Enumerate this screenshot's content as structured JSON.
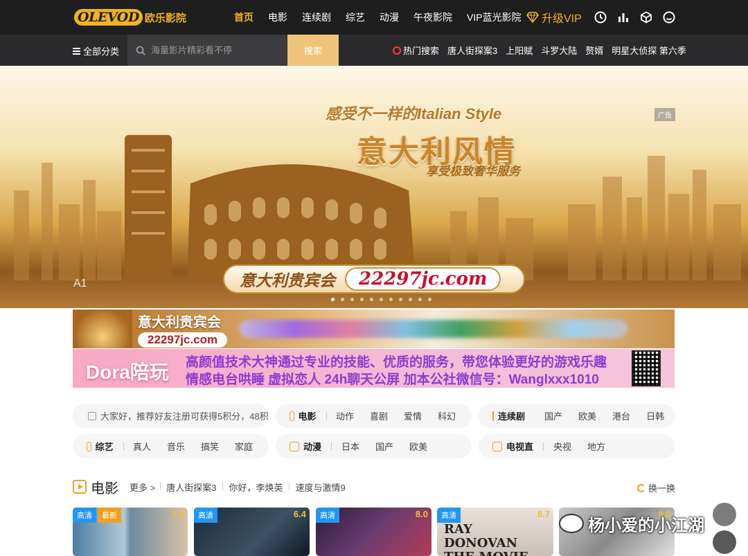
{
  "brand": {
    "logo_mark": "OLEVOD",
    "logo_text": "欧乐影院"
  },
  "nav": [
    {
      "label": "首页",
      "active": true
    },
    {
      "label": "电影"
    },
    {
      "label": "连续剧"
    },
    {
      "label": "综艺"
    },
    {
      "label": "动漫"
    },
    {
      "label": "午夜影院"
    },
    {
      "label": "VIP蓝光影院"
    }
  ],
  "vip_label": "升级VIP",
  "top_icons": [
    "clock-icon",
    "bar-chart-icon",
    "cube-icon",
    "smiley-icon"
  ],
  "subbar": {
    "all_categories": "全部分类",
    "search_placeholder": "海量影片精彩看不停",
    "search_button": "搜索",
    "hot_label": "热门搜索",
    "hot_items": [
      "唐人街探案3",
      "上阳赋",
      "斗罗大陆",
      "赘婿",
      "明星大侦探 第六季"
    ]
  },
  "banner": {
    "subtitle": "感受不一样的Italian Style",
    "title": "意大利风情",
    "slogan": "享受极致奢华服务",
    "ad_tag": "广告",
    "pill_left": "意大利贵宾会",
    "pill_right": "22297jc.com",
    "slide_label": "A1",
    "slide_count": 11,
    "active_slide": 0
  },
  "ad_strip_1": {
    "title": "意大利贵宾会",
    "url": "22297jc.com"
  },
  "ad_strip_2": {
    "brand": "Dora陪玩",
    "line1": "高颜值技术大神通过专业的技能、优质的服务，带您体验更好的游戏乐趣",
    "line2": "情感电台哄睡  虚拟恋人  24h聊天公屏  加本公社微信号：Wanglxxx1010"
  },
  "notice": "大家好，推荐好友注册可获得5积分，48积",
  "categories": [
    {
      "head": "电影",
      "subs": [
        "动作",
        "喜剧",
        "爱情",
        "科幻"
      ]
    },
    {
      "head": "连续剧",
      "subs": [
        "国产",
        "欧美",
        "港台",
        "日韩"
      ]
    },
    {
      "head": "综艺",
      "subs": [
        "真人",
        "音乐",
        "搞笑",
        "家庭"
      ]
    },
    {
      "head": "动漫",
      "subs": [
        "日本",
        "国产",
        "欧美"
      ]
    },
    {
      "head": "电视直",
      "subs": [
        "央视",
        "地方"
      ]
    }
  ],
  "section": {
    "title": "电影",
    "more": "更多 >",
    "links": [
      "唐人街探案3",
      "你好，李焕英",
      "速度与激情9"
    ],
    "swap": "换一换"
  },
  "cards": [
    {
      "badge": "高清",
      "badge2": "最新",
      "score": "7.5",
      "caption": ""
    },
    {
      "badge": "高清",
      "score": "6.4",
      "caption": ""
    },
    {
      "badge": "高清",
      "score": "8.0",
      "caption": ""
    },
    {
      "badge": "高清",
      "score": "8.7",
      "caption": "RAY DONOVAN THE MOVIE"
    },
    {
      "badge": "",
      "score": "8.0",
      "caption": ""
    }
  ],
  "watermark": "杨小爱的小江湖",
  "colors": {
    "accent": "#f0b323",
    "topbar": "#1e1e1f",
    "subbar": "#2a2a2c",
    "search_btn": "#f0c478",
    "badge_blue": "#2196f3"
  }
}
